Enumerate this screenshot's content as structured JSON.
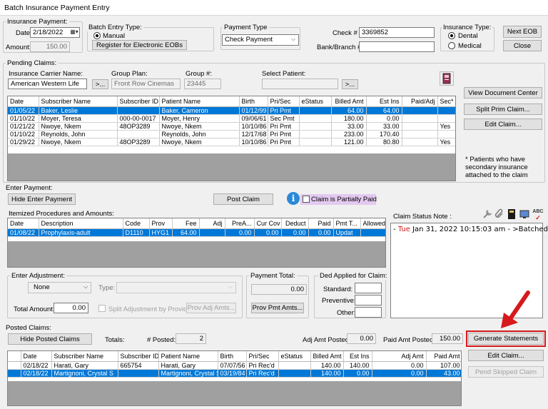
{
  "window": {
    "title": "Batch Insurance Payment Entry"
  },
  "insurance_payment": {
    "group_label": "Insurance Payment:",
    "date_label": "Date:",
    "date_value": "2/18/2022",
    "amount_label": "Amount:",
    "amount_value": "150.00"
  },
  "batch_entry": {
    "group_label": "Batch Entry Type:",
    "manual_label": "Manual",
    "register_button": "Register for Electronic EOBs"
  },
  "payment_type": {
    "group_label": "Payment Type",
    "value": "Check Payment"
  },
  "check": {
    "check_label": "Check #",
    "check_value": "3369852",
    "bank_label": "Bank/Branch #",
    "bank_value": ""
  },
  "insurance_type": {
    "group_label": "Insurance Type:",
    "dental_label": "Dental",
    "medical_label": "Medical",
    "selected": "Dental"
  },
  "top_buttons": {
    "next_eob": "Next EOB",
    "close": "Close"
  },
  "pending": {
    "group_label": "Pending Claims:",
    "carrier_label": "Insurance Carrier Name:",
    "carrier_value": "American Western Life",
    "carrier_btn": ">...",
    "group_plan_label": "Group Plan:",
    "group_plan_value": "Front Row Cinemas",
    "group_num_label": "Group #:",
    "group_num_value": "23445",
    "patient_label": "Select Patient:",
    "patient_value": "",
    "patient_btn": ">...",
    "columns": [
      "Date",
      "Subscriber Name",
      "Subscriber ID",
      "Patient Name",
      "Birth",
      "Pri/Sec",
      "eStatus",
      "Billed Amt",
      "Est Ins",
      "Paid/Adj",
      "Sec*"
    ],
    "rows": [
      [
        "01/05/22",
        "Baker, Leslie",
        "",
        "Baker, Cameron",
        "01/12/99",
        "Pri Pmt",
        "",
        "64.00",
        "64.00",
        "",
        ""
      ],
      [
        "01/10/22",
        "Moyer, Teresa",
        "000-00-0017",
        "Moyer, Henry",
        "09/06/61",
        "Sec Pmt",
        "",
        "180.00",
        "0.00",
        "",
        ""
      ],
      [
        "01/21/22",
        "Nwoye, Nkem",
        "48OP3289",
        "Nwoye, Nkem",
        "10/10/86",
        "Pri Pmt",
        "",
        "33.00",
        "33.00",
        "",
        "Yes"
      ],
      [
        "01/10/22",
        "Reynolds, John",
        "",
        "Reynolds, John",
        "12/17/68",
        "Pri Pmt",
        "",
        "233.00",
        "170.40",
        "",
        ""
      ],
      [
        "01/29/22",
        "Nwoye, Nkem",
        "48OP3289",
        "Nwoye, Nkem",
        "10/10/86",
        "Pri Pmt",
        "",
        "121.00",
        "80.80",
        "",
        "Yes"
      ]
    ],
    "selected_row": 0,
    "buttons": {
      "view_doc": "View Document Center",
      "split": "Split Prim Claim...",
      "edit": "Edit Claim..."
    },
    "note": "* Patients who have secondary insurance attached to the claim"
  },
  "enter_payment": {
    "group_label": "Enter Payment:",
    "hide_btn": "Hide Enter Payment",
    "post_btn": "Post Claim",
    "partial_label": "Claim is Partially Paid",
    "itemized_label": "Itemized Procedures and Amounts:",
    "columns": [
      "Date",
      "Description",
      "Code",
      "Prov",
      "Fee",
      "Adj",
      "PreA...",
      "Cur Cov",
      "Deduct",
      "Paid",
      "Pmt T...",
      "Allowed"
    ],
    "rows": [
      [
        "01/08/22",
        "Prophylaxis-adult",
        "D1110",
        "HYG1",
        "64.00",
        "",
        "0.00",
        "0.00",
        "0.00",
        "0.00",
        "Updat",
        ""
      ]
    ],
    "adjustment": {
      "group_label": "Enter Adjustment:",
      "value": "None",
      "type_label": "Type:",
      "total_label": "Total Amount:",
      "total_value": "0.00",
      "split_label": "Split Adjustment by Provider",
      "prov_btn": "Prov Adj Amts..."
    },
    "payment_total": {
      "group_label": "Payment Total:",
      "value": "0.00",
      "btn": "Prov Pmt Amts..."
    },
    "deductible": {
      "group_label": "Ded Applied for Claim:",
      "standard": "Standard:",
      "preventive": "Preventive:",
      "other": "Other:"
    }
  },
  "claim_status": {
    "label": "Claim Status Note :",
    "day": "Tue",
    "rest": " Jan 31, 2022 10:15:03 am - >Batched"
  },
  "posted": {
    "group_label": "Posted Claims:",
    "hide_btn": "Hide Posted Claims",
    "totals_label": "Totals:",
    "num_posted_label": "# Posted:",
    "num_posted_value": "2",
    "adj_label": "Adj Amt Posted:",
    "adj_value": "0.00",
    "paid_label": "Paid Amt Posted:",
    "paid_value": "150.00",
    "columns": [
      "Date",
      "Subscriber Name",
      "Subscriber ID",
      "Patient Name",
      "Birth",
      "Pri/Sec",
      "eStatus",
      "Billed Amt",
      "Est Ins",
      "Adj Amt",
      "Paid Amt"
    ],
    "rows": [
      [
        "02/18/22",
        "Harati, Gary",
        "665754",
        "Harati, Gary",
        "07/07/56",
        "Pri Rec'd",
        "",
        "140.00",
        "140.00",
        "0.00",
        "107.00"
      ],
      [
        "02/18/22",
        "Martignoni, Crystal S",
        "",
        "Martignoni, Crystal S",
        "03/19/84",
        "Pri Rec'd",
        "",
        "140.00",
        "0.00",
        "0.00",
        "43.00"
      ]
    ],
    "selected_row": 1,
    "buttons": {
      "generate": "Generate Statements",
      "edit": "Edit Claim...",
      "pend": "Pend Skipped Claim"
    }
  },
  "colors": {
    "accent": "#0078d7",
    "highlight": "#d7191c",
    "partial_bg": "#e3c9f0"
  }
}
